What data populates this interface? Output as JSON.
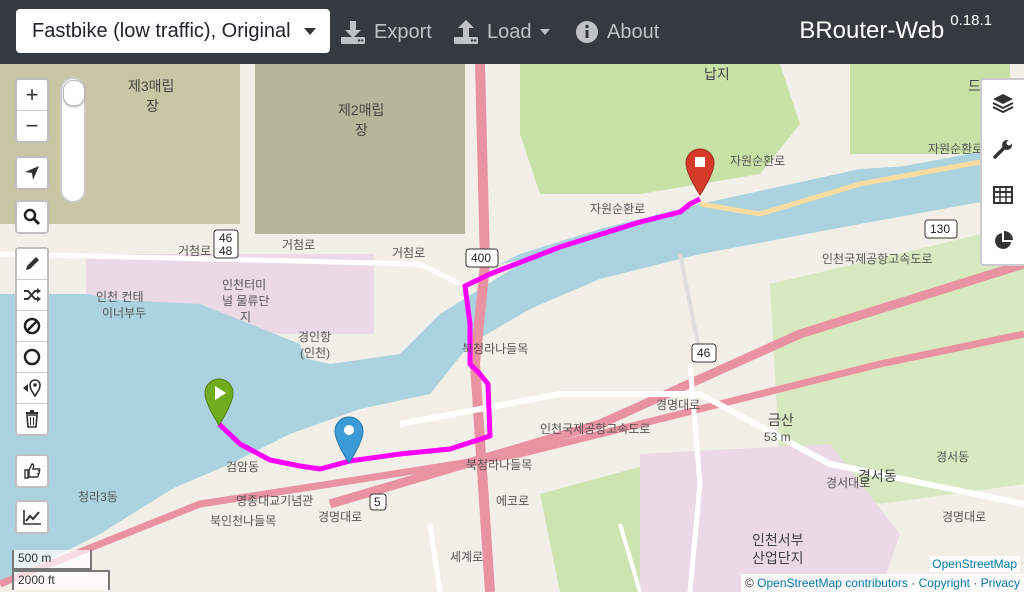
{
  "navbar": {
    "profile_selected": "Fastbike (low traffic), Original",
    "export_label": "Export",
    "load_label": "Load",
    "about_label": "About",
    "brand": "BRouter-Web",
    "version": "0.18.1"
  },
  "map_controls": {
    "zoom_in": "+",
    "zoom_out": "−",
    "icons": [
      "locate-icon",
      "search-icon",
      "draw-route-icon",
      "shuffle-icon",
      "no-go-icon",
      "circle-icon",
      "reverse-route-icon",
      "delete-icon",
      "thumb-icon",
      "elevation-icon"
    ]
  },
  "right_controls": [
    "layers-icon",
    "wrench-icon",
    "table-icon",
    "pie-chart-icon"
  ],
  "scale": {
    "metric": "500 m",
    "imperial": "2000 ft"
  },
  "attribution": {
    "osm_tag": "OpenStreetMap",
    "prefix": "©",
    "contributors": "OpenStreetMap contributors",
    "copyright": "Copyright",
    "privacy": "Privacy",
    "sep": "·"
  },
  "map_labels": {
    "l1": "제3매립",
    "l2": "장",
    "l3": "제2매립",
    "l4": "장",
    "l5": "드림파",
    "l6": "자원순환로",
    "l7": "자원순환로",
    "l8": "자원순환로",
    "l9": "거첨로",
    "l10": "거첨로",
    "l11": "거첨로",
    "l12": "인천 컨테",
    "l13": "이너부두",
    "l14": "인천터미",
    "l15": "널 물류단",
    "l16": "지",
    "l17": "경인항",
    "l18": "(인천)",
    "l19": "북청라나들목",
    "l20": "북청라나들목",
    "l21": "인천국제공항고속도로",
    "l22": "인천국제공항고속도로",
    "l23": "경명대로",
    "l24": "경명대로",
    "l25": "금산",
    "l26": "53 m",
    "l27": "경서동",
    "l28": "경서동",
    "l29": "인천서부",
    "l30": "산업단지",
    "l31": "검암동",
    "l32": "영종대교기념관",
    "l33": "북인천나들목",
    "l34": "청라3동",
    "l35": "에코로",
    "l36": "세계로",
    "l37": "경서대로",
    "l38": "경명대로",
    "shield_400": "400",
    "shield_130": "130",
    "shield_46": "46",
    "shield_46b": "46",
    "shield_48": "48",
    "shield_5": "5",
    "l39": "납지"
  },
  "colors": {
    "route": "#ff00ff",
    "start": "#6fad1e",
    "end": "#d63b2a",
    "via": "#3a9bd6"
  }
}
